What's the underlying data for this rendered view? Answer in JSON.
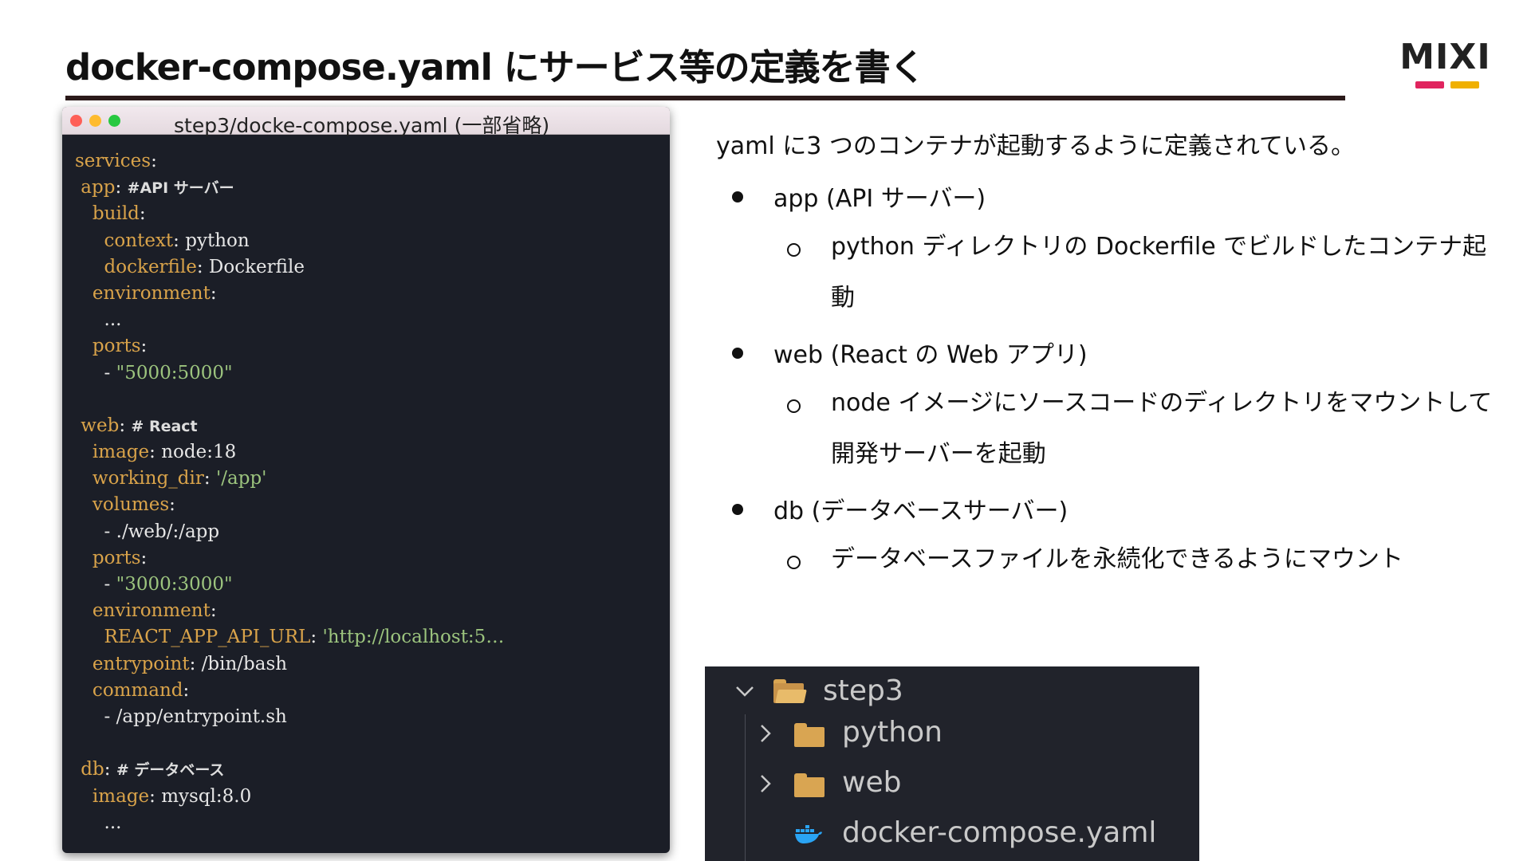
{
  "slide": {
    "title": "docker-compose.yaml にサービス等の定義を書く",
    "logo": "MIXI"
  },
  "editor": {
    "window_title": "step3/docke-compose.yaml (一部省略)",
    "lines": [
      [
        {
          "t": "services",
          "c": "k"
        },
        {
          "t": ":",
          "c": "p"
        }
      ],
      [
        {
          "t": " app",
          "c": "k"
        },
        {
          "t": ": ",
          "c": "p"
        },
        {
          "t": "#API サーバー",
          "c": "c"
        }
      ],
      [
        {
          "t": "   build",
          "c": "k"
        },
        {
          "t": ":",
          "c": "p"
        }
      ],
      [
        {
          "t": "     context",
          "c": "k"
        },
        {
          "t": ": python",
          "c": "p"
        }
      ],
      [
        {
          "t": "     dockerfile",
          "c": "k"
        },
        {
          "t": ": Dockerfile",
          "c": "p"
        }
      ],
      [
        {
          "t": "   environment",
          "c": "k"
        },
        {
          "t": ":",
          "c": "p"
        }
      ],
      [
        {
          "t": "     ...",
          "c": "p"
        }
      ],
      [
        {
          "t": "   ports",
          "c": "k"
        },
        {
          "t": ":",
          "c": "p"
        }
      ],
      [
        {
          "t": "     - ",
          "c": "p"
        },
        {
          "t": "\"5000:5000\"",
          "c": "s"
        }
      ],
      [],
      [
        {
          "t": " web",
          "c": "k"
        },
        {
          "t": ": ",
          "c": "p"
        },
        {
          "t": "# React",
          "c": "c"
        }
      ],
      [
        {
          "t": "   image",
          "c": "k"
        },
        {
          "t": ": node:18",
          "c": "p"
        }
      ],
      [
        {
          "t": "   working_dir",
          "c": "k"
        },
        {
          "t": ": ",
          "c": "p"
        },
        {
          "t": "'/app'",
          "c": "s"
        }
      ],
      [
        {
          "t": "   volumes",
          "c": "k"
        },
        {
          "t": ":",
          "c": "p"
        }
      ],
      [
        {
          "t": "     - ./web/:/app",
          "c": "p"
        }
      ],
      [
        {
          "t": "   ports",
          "c": "k"
        },
        {
          "t": ":",
          "c": "p"
        }
      ],
      [
        {
          "t": "     - ",
          "c": "p"
        },
        {
          "t": "\"3000:3000\"",
          "c": "s"
        }
      ],
      [
        {
          "t": "   environment",
          "c": "k"
        },
        {
          "t": ":",
          "c": "p"
        }
      ],
      [
        {
          "t": "     REACT_APP_API_URL",
          "c": "k"
        },
        {
          "t": ": ",
          "c": "p"
        },
        {
          "t": "'http://localhost:5…",
          "c": "s"
        }
      ],
      [
        {
          "t": "   entrypoint",
          "c": "k"
        },
        {
          "t": ": /bin/bash",
          "c": "p"
        }
      ],
      [
        {
          "t": "   command",
          "c": "k"
        },
        {
          "t": ":",
          "c": "p"
        }
      ],
      [
        {
          "t": "     - /app/entrypoint.sh",
          "c": "p"
        }
      ],
      [],
      [
        {
          "t": " db",
          "c": "k"
        },
        {
          "t": ": ",
          "c": "p"
        },
        {
          "t": "# データベース",
          "c": "c"
        }
      ],
      [
        {
          "t": "   image",
          "c": "k"
        },
        {
          "t": ": mysql:8.0",
          "c": "p"
        }
      ],
      [
        {
          "t": "     ...",
          "c": "p"
        }
      ]
    ]
  },
  "description": {
    "intro": "yaml に3 つのコンテナが起動するように定義されている。",
    "app_label": "app (API サーバー)",
    "app_detail_1": "python ディレクトリの Dockerfile でビルドしたコンテナ起",
    "app_detail_2": "動",
    "web_label": "web (React の Web アプリ)",
    "web_detail_1": "node イメージにソースコードのディレクトリをマウントして",
    "web_detail_2": "開発サーバーを起動",
    "db_label": "db (データベースサーバー)",
    "db_detail": "データベースファイルを永続化できるようにマウント"
  },
  "explorer": {
    "root": "step3",
    "python": "python",
    "web": "web",
    "compose": "docker-compose.yaml"
  },
  "colors": {
    "code_bg": "#1b1e27",
    "key": "#d9a34a",
    "string": "#9cc47e",
    "logo_red": "#e0245e",
    "logo_yellow": "#f0b000"
  }
}
